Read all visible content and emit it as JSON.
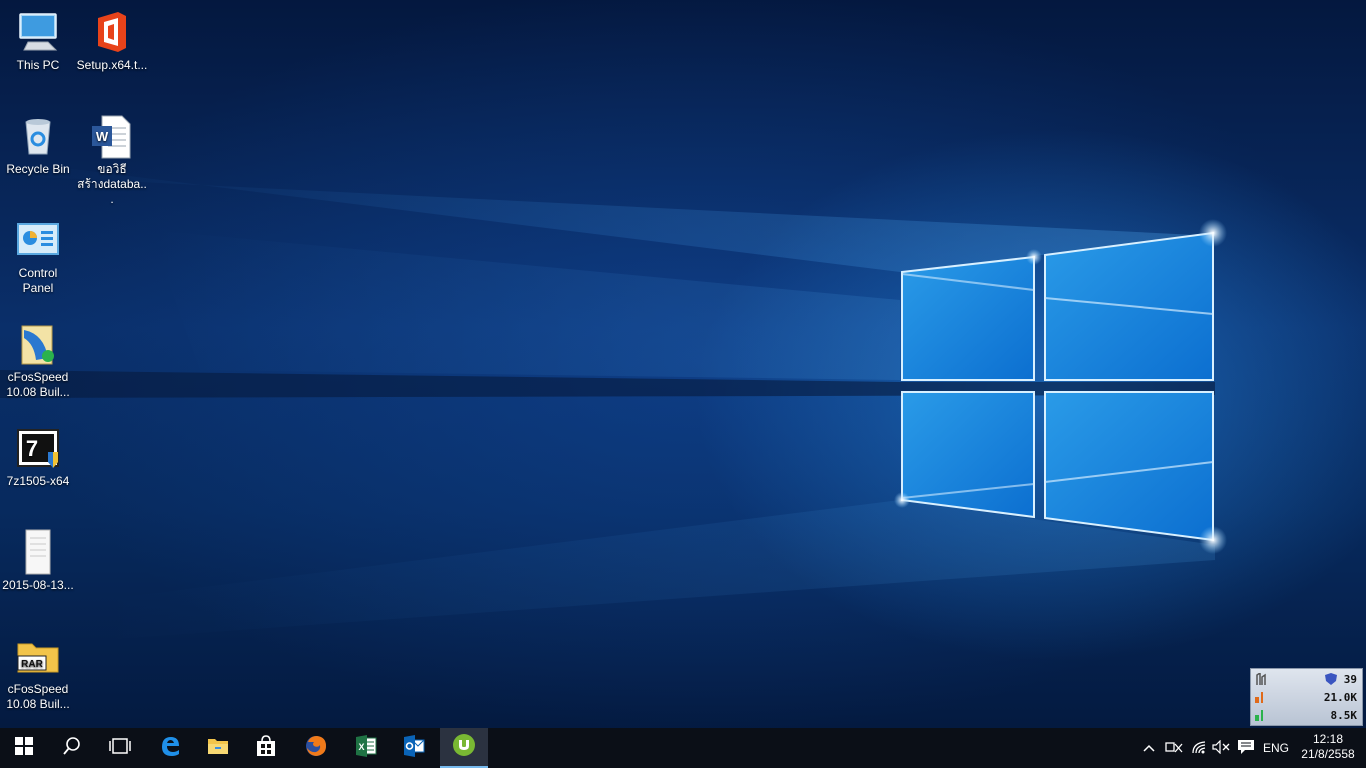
{
  "desktop": {
    "icons": [
      {
        "name": "this-pc",
        "label": "This PC"
      },
      {
        "name": "setup",
        "label": "Setup.x64.t..."
      },
      {
        "name": "recycle-bin",
        "label": "Recycle Bin"
      },
      {
        "name": "word-doc",
        "label": "ขอวิธีสร้างdataba..."
      },
      {
        "name": "control-panel",
        "label": "Control Panel"
      },
      {
        "name": "cfosspeed-installer",
        "label": "cFosSpeed 10.08 Buil..."
      },
      {
        "name": "7zip-installer",
        "label": "7z1505-x64"
      },
      {
        "name": "document-2015",
        "label": "2015-08-13..."
      },
      {
        "name": "cfosspeed-rar",
        "label": "cFosSpeed 10.08 Buil..."
      }
    ]
  },
  "cfos": {
    "pings": "39",
    "upload": "21.0K",
    "download": "8.5K"
  },
  "taskbar": {
    "pinned": [
      "start-icon",
      "search-icon",
      "task-view-icon",
      "edge-icon",
      "file-explorer-icon",
      "store-icon",
      "firefox-icon",
      "excel-icon",
      "outlook-icon",
      "utorrent-icon"
    ],
    "language": "ENG",
    "time": "12:18",
    "date": "21/8/2558"
  },
  "colors": {
    "taskbar": "#0b0f17",
    "accent": "#76b9ed",
    "wallpaper": "#0a2f6a"
  }
}
